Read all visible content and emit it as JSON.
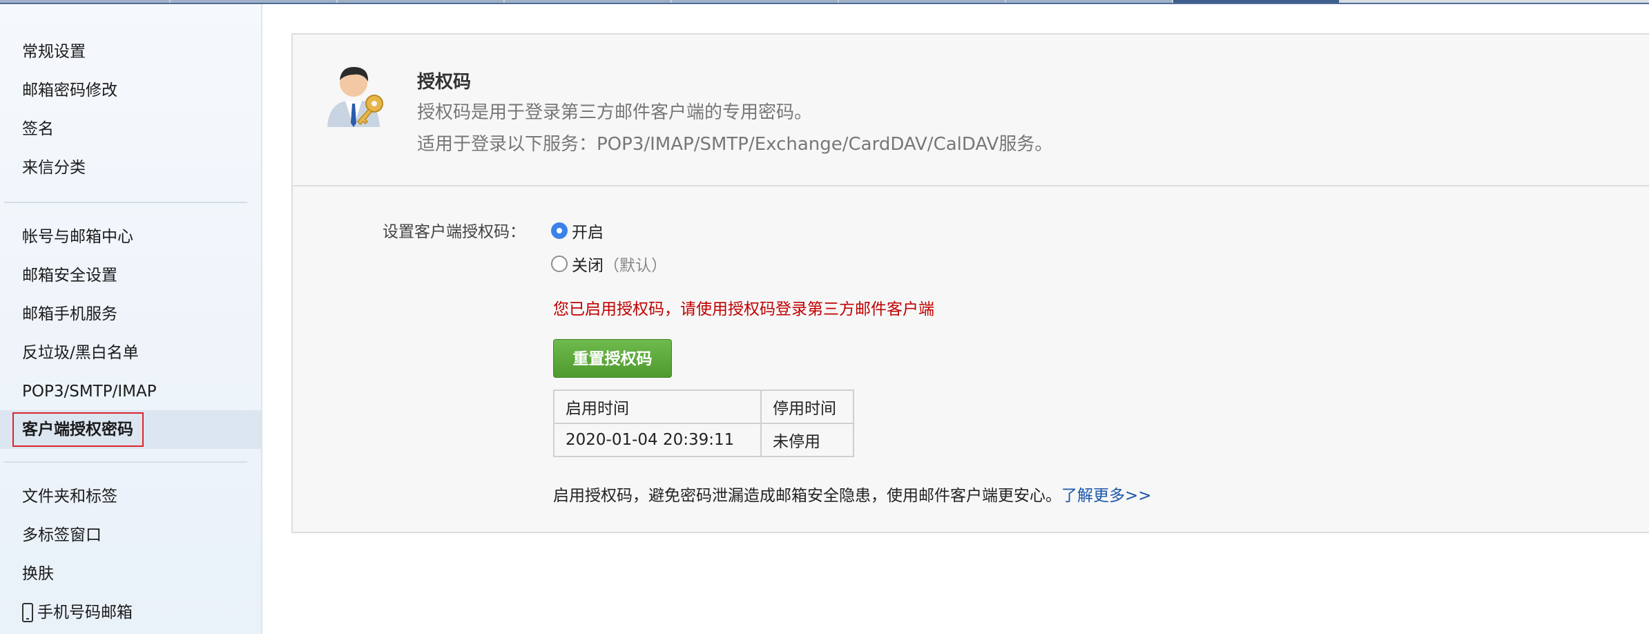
{
  "colors": {
    "accent_blue": "#3b82e8",
    "notice_red": "#c00000",
    "button_green": "#5aa83a",
    "link_blue": "#1a56a8",
    "selection_outline": "#d9262c"
  },
  "sidebar": {
    "group1": [
      "常规设置",
      "邮箱密码修改",
      "签名",
      "来信分类"
    ],
    "group2": [
      "帐号与邮箱中心",
      "邮箱安全设置",
      "邮箱手机服务",
      "反垃圾/黑白名单",
      "POP3/SMTP/IMAP",
      "客户端授权密码"
    ],
    "group3": [
      "文件夹和标签",
      "多标签窗口",
      "换肤",
      "手机号码邮箱"
    ],
    "selected": "客户端授权密码"
  },
  "header": {
    "icon": "user-key-icon",
    "title": "授权码",
    "desc1": "授权码是用于登录第三方邮件客户端的专用密码。",
    "desc2": "适用于登录以下服务：POP3/IMAP/SMTP/Exchange/CardDAV/CalDAV服务。"
  },
  "settings": {
    "label": "设置客户端授权码：",
    "options": [
      {
        "label": "开启",
        "note": "",
        "checked": true
      },
      {
        "label": "关闭",
        "note": "（默认）",
        "checked": false
      }
    ],
    "notice": "您已启用授权码，请使用授权码登录第三方邮件客户端",
    "reset_button": "重置授权码"
  },
  "table": {
    "headers": [
      "启用时间",
      "停用时间"
    ],
    "rows": [
      [
        "2020-01-04 20:39:11",
        "未停用"
      ]
    ]
  },
  "footer": {
    "text": "启用授权码，避免密码泄漏造成邮箱安全隐患，使用邮件客户端更安心。",
    "link": "了解更多>>"
  }
}
